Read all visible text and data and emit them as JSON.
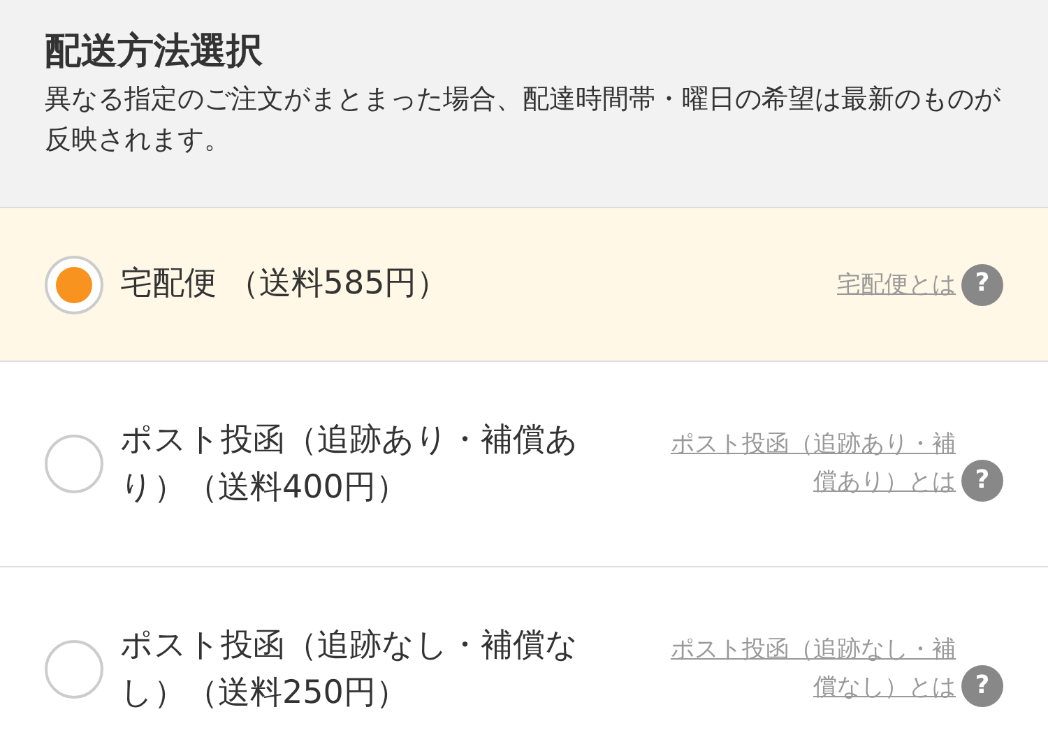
{
  "header": {
    "title": "配送方法選択",
    "description": "異なる指定のご注文がまとまった場合、配達時間帯・曜日の希望は最新のものが反映されます。"
  },
  "options": [
    {
      "label": "宅配便 （送料585円）",
      "link": "宅配便とは",
      "help": "?",
      "selected": true
    },
    {
      "label": "ポスト投函（追跡あり・補償あり）（送料400円）",
      "link": "ポスト投函（追跡あり・補償あり）とは",
      "help": "?",
      "selected": false
    },
    {
      "label": "ポスト投函（追跡なし・補償なし）（送料250円）",
      "link": "ポスト投函（追跡なし・補償なし）とは",
      "help": "?",
      "selected": false
    }
  ]
}
